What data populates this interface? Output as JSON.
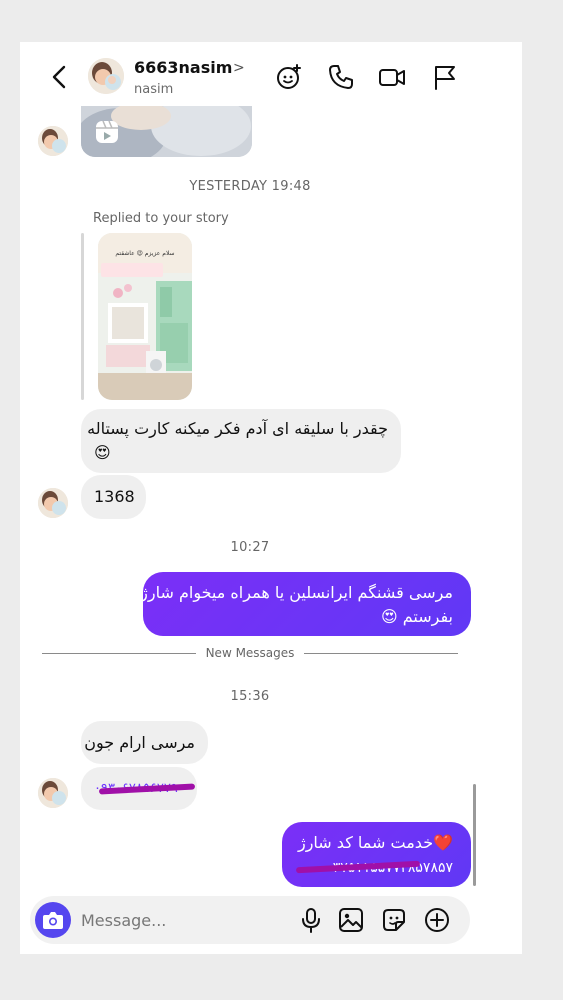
{
  "header": {
    "username": "6663nasim",
    "chevron": ">",
    "handle": "nasim"
  },
  "icons": {
    "back": "chevron-left-icon",
    "effects": "sparkle-face-icon",
    "call": "phone-icon",
    "video": "video-camera-icon",
    "report": "flag-icon",
    "reel": "reel-icon",
    "camera": "camera-icon",
    "mic": "microphone-icon",
    "gallery": "gallery-icon",
    "sticker": "sticker-icon",
    "plus": "plus-circle-icon"
  },
  "messages": {
    "timestamp_yesterday": "YESTERDAY 19:48",
    "replied_label": "Replied to your story",
    "story_caption": "سلام عزیزم 😍 عاشقتم",
    "reply_text": "چقدر با سلیقه ای آدم فکر میکنه کارت پستاله",
    "reply_emoji": "😍",
    "number_message": "1368",
    "timestamp_1027": "10:27",
    "outgoing_1_line1": "مرسی قشنگم ایرانسلین یا همراه میخوام شارژ",
    "outgoing_1_line2": "بفرستم",
    "outgoing_1_emoji": "😍",
    "new_messages_label": "New Messages",
    "timestamp_1536": "15:36",
    "incoming_thanks": "مرسی ارام جون",
    "incoming_phone": "۰۹۳۰۶۷۸۵۶۷۷۹",
    "outgoing_2_line1": "خدمت شما کد شارژ",
    "outgoing_2_emoji": "❤️",
    "outgoing_2_line2": "۳۷۵۱۱۵۵۷۷۳۸۵۷۸۵۷"
  },
  "composer": {
    "placeholder": "Message..."
  },
  "colors": {
    "accent": "#6d33ff",
    "camera_button": "#5546ef",
    "incoming_bubble": "#efefef",
    "redaction": "#a010a8"
  }
}
